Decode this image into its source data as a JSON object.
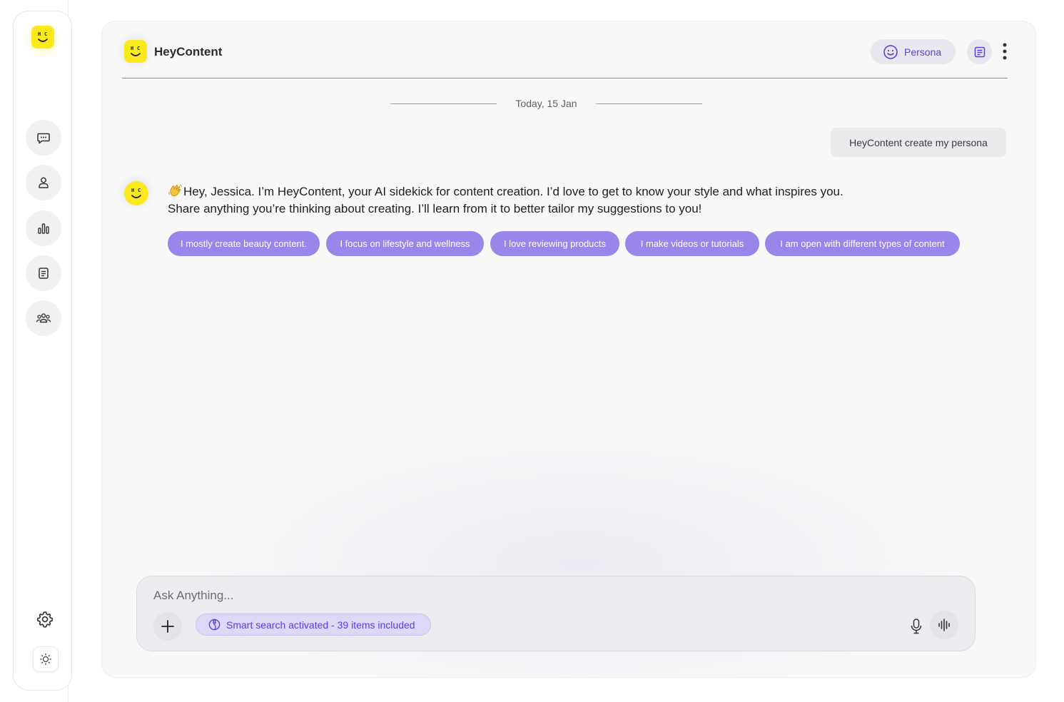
{
  "app": {
    "brand_name": "HeyContent",
    "logo_letters": "H C",
    "accent_color": "#5a3fe0",
    "chip_color": "#9a86ea",
    "logo_color": "#fbe81d"
  },
  "sidebar": {
    "items": [
      {
        "icon": "chat-icon"
      },
      {
        "icon": "user-icon"
      },
      {
        "icon": "analytics-icon"
      },
      {
        "icon": "notes-icon"
      },
      {
        "icon": "community-icon"
      }
    ],
    "settings_icon": "gear-icon",
    "theme_icon": "sun-icon"
  },
  "header": {
    "persona_label": "Persona",
    "persona_icon": "smiley-icon",
    "doc_icon": "document-icon",
    "more_icon": "more-vertical-icon"
  },
  "conversation": {
    "date_label": "Today, 15 Jan",
    "user_message": "HeyContent create my persona",
    "bot_message_line1": "Hey, Jessica. I’m HeyContent, your AI sidekick for content creation. I’d love to get to know your style and what inspires you.",
    "bot_message_line2": "Share anything you’re thinking about creating. I’ll learn from it to better tailor my suggestions to you!",
    "suggestions": [
      "I mostly create beauty content.",
      "I focus on lifestyle and wellness",
      "I love reviewing products",
      "I make videos or tutorials",
      "I am open with different types of content"
    ]
  },
  "composer": {
    "placeholder": "Ask Anything...",
    "smart_search_label": "Smart search activated - 39 items included",
    "add_icon": "plus-icon",
    "mic_icon": "microphone-icon",
    "voice_icon": "waveform-icon"
  }
}
